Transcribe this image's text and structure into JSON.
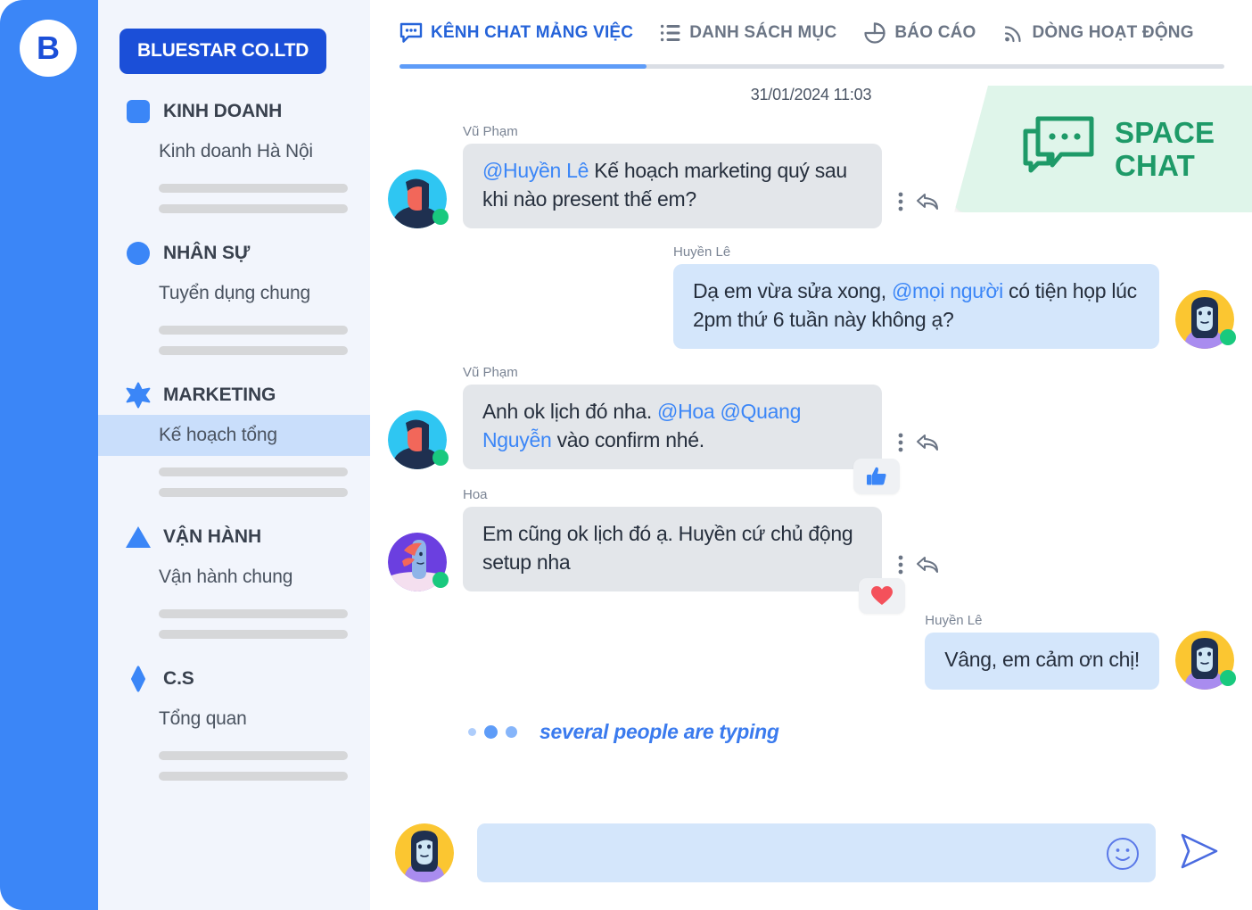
{
  "brand": {
    "logo_letter": "B",
    "org_name": "BLUESTAR CO.LTD",
    "rail_color": "#3B86F7",
    "accent_color": "#3B86F7",
    "badge_color": "#1B4FD8"
  },
  "sidebar": {
    "groups": [
      {
        "icon": "square-icon",
        "title": "KINH DOANH",
        "items": [
          {
            "label": "Kinh doanh Hà Nội",
            "active": false
          }
        ],
        "placeholder_bars": 2
      },
      {
        "icon": "circle-icon",
        "title": "NHÂN SỰ",
        "items": [
          {
            "label": "Tuyển dụng chung",
            "active": false
          }
        ],
        "placeholder_bars": 2
      },
      {
        "icon": "star-icon",
        "title": "MARKETING",
        "items": [
          {
            "label": "Kế hoạch tổng",
            "active": true
          }
        ],
        "placeholder_bars": 2
      },
      {
        "icon": "triangle-icon",
        "title": "VẬN HÀNH",
        "items": [
          {
            "label": "Vận hành chung",
            "active": false
          }
        ],
        "placeholder_bars": 2
      },
      {
        "icon": "diamond-icon",
        "title": "C.S",
        "items": [
          {
            "label": "Tổng quan",
            "active": false
          }
        ],
        "placeholder_bars": 2
      }
    ]
  },
  "tabs": [
    {
      "icon": "chat-bubble-icon",
      "label": "KÊNH CHAT MẢNG VIỆC",
      "active": true
    },
    {
      "icon": "list-icon",
      "label": "DANH SÁCH MỤC",
      "active": false
    },
    {
      "icon": "pie-chart-icon",
      "label": "BÁO CÁO",
      "active": false
    },
    {
      "icon": "rss-feed-icon",
      "label": "DÒNG HOẠT ĐỘNG",
      "active": false
    }
  ],
  "space_badge": {
    "icon": "space-chat-icon",
    "line1": "SPACE",
    "line2": "CHAT",
    "color": "#1E9A68",
    "background": "#DFF5EA"
  },
  "chat": {
    "timestamp": "31/01/2024 11:03",
    "messages": [
      {
        "sender": "Vũ Phạm",
        "side": "left",
        "avatar": "avatar-vu-pham",
        "online": true,
        "mention": "@Huyền Lê",
        "text": " Kế hoạch marketing quý sau khi nào present thế em?",
        "has_actions": true,
        "reaction": null
      },
      {
        "sender": "Huyền Lê",
        "side": "right",
        "avatar": "avatar-huyen-le",
        "online": true,
        "text_before": "Dạ em vừa sửa xong, ",
        "mention": "@mọi người",
        "text_after": " có tiện họp lúc 2pm thứ 6 tuần này không ạ?",
        "has_actions": false,
        "reaction": null
      },
      {
        "sender": "Vũ Phạm",
        "side": "left",
        "avatar": "avatar-vu-pham",
        "online": true,
        "text_before": "Anh ok lịch đó nha.  ",
        "mention": "@Hoa @Quang Nguyễn",
        "text_after": " vào confirm nhé.",
        "has_actions": true,
        "reaction": "thumbs-up"
      },
      {
        "sender": "Hoa",
        "side": "left",
        "avatar": "avatar-hoa",
        "online": true,
        "text": "Em cũng ok lịch đó ạ. Huyền cứ chủ động setup nha",
        "has_actions": true,
        "reaction": "heart"
      },
      {
        "sender": "Huyền Lê",
        "side": "right",
        "avatar": "avatar-huyen-le",
        "online": true,
        "text": "Vâng, em cảm ơn chị!",
        "has_actions": false,
        "reaction": null
      }
    ],
    "typing_indicator": "several people are typing"
  },
  "composer": {
    "avatar": "avatar-current-user",
    "value": "",
    "placeholder": "",
    "emoji_icon": "smiley-icon",
    "send_icon": "send-icon"
  }
}
